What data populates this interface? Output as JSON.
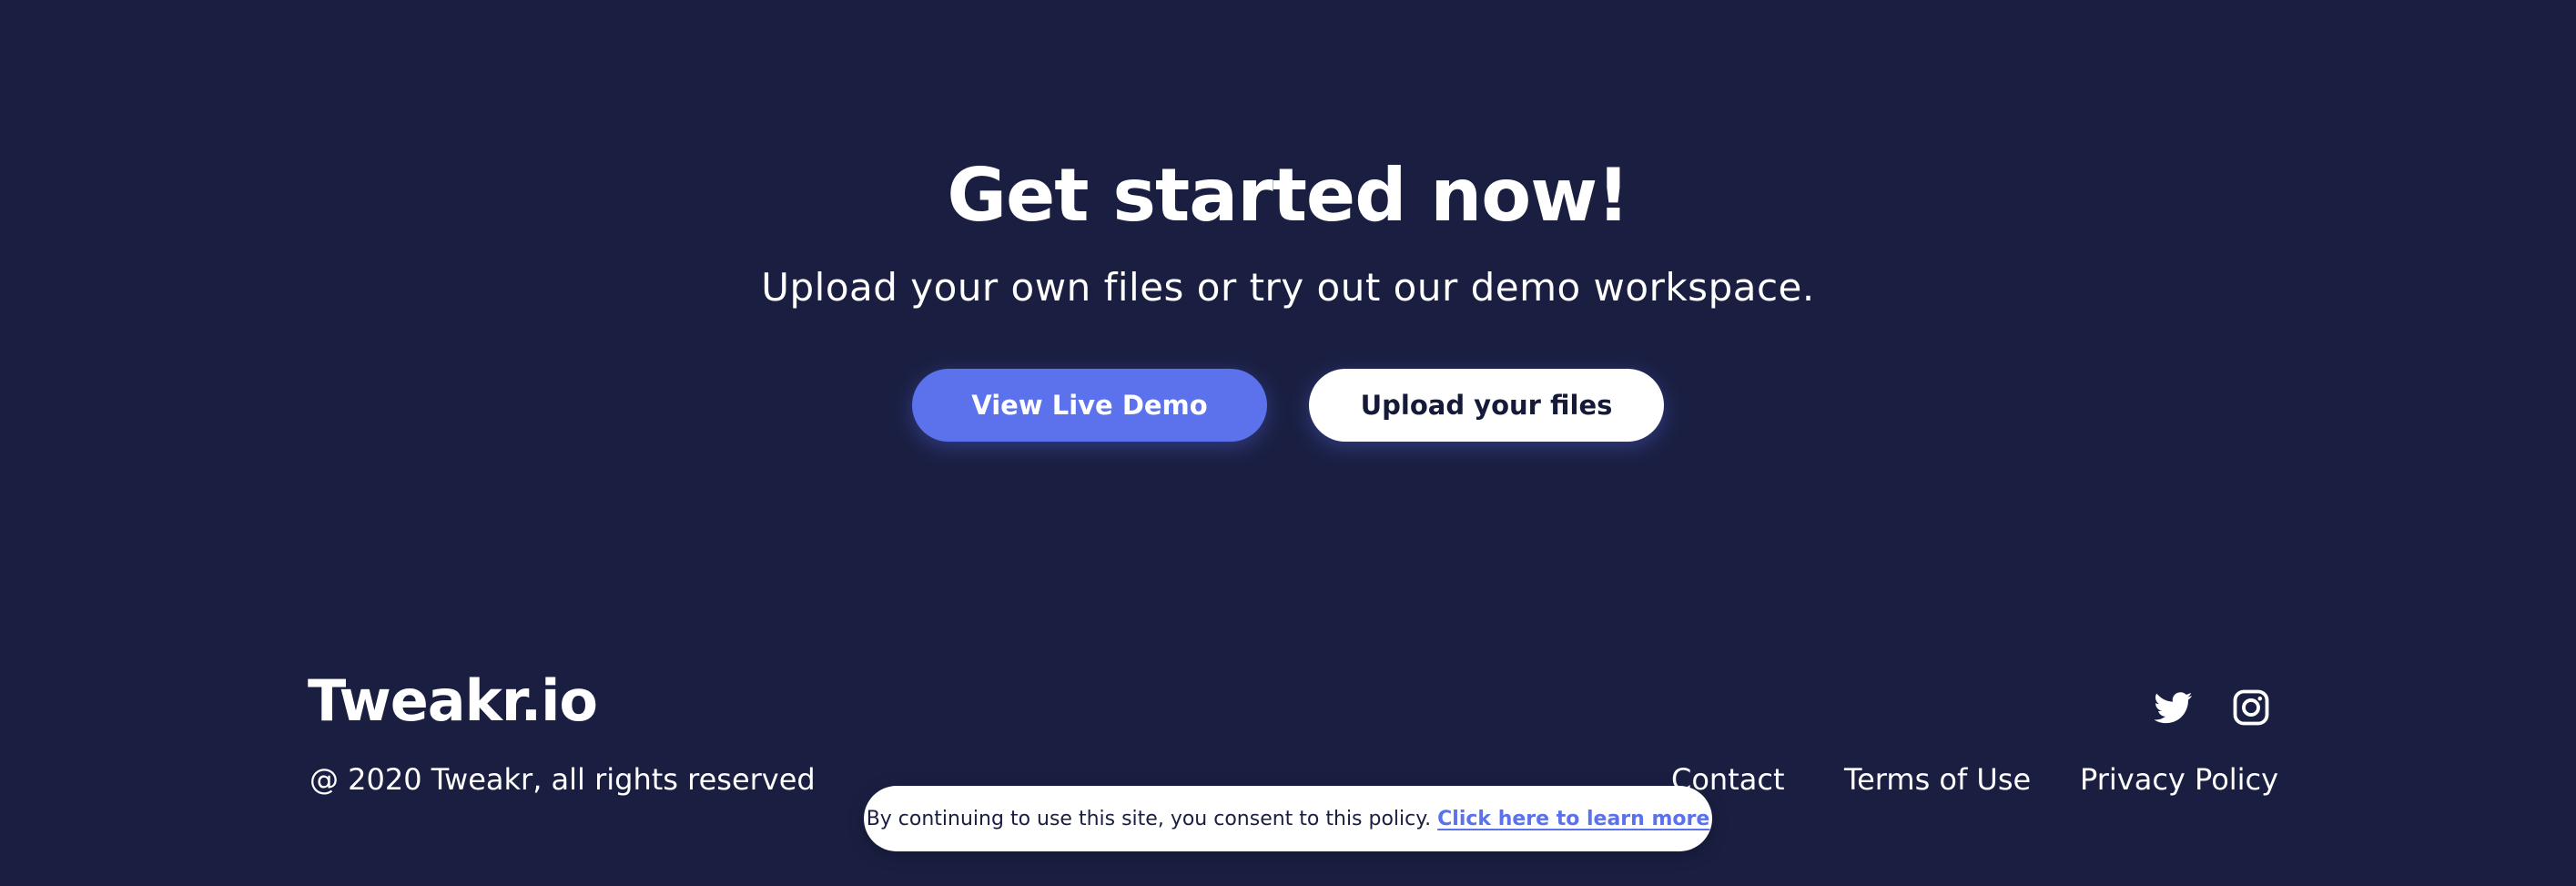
{
  "hero": {
    "title": "Get started now!",
    "subtitle": "Upload your own files or try out our demo workspace.",
    "primary_button_label": "View Live Demo",
    "secondary_button_label": "Upload your files"
  },
  "footer": {
    "logo_text": "Tweakr.io",
    "copyright": "@ 2020 Tweakr, all rights reserved",
    "social_icons": [
      "twitter-icon",
      "instagram-icon"
    ],
    "links": {
      "contact": "Contact",
      "terms": "Terms of Use",
      "privacy": "Privacy Policy"
    }
  },
  "cookie_banner": {
    "text": "By continuing to use this site, you consent to this policy.",
    "link_text": "Click here to learn more"
  },
  "colors": {
    "background": "#1a1f42",
    "accent": "#5b72ec",
    "text": "#ffffff"
  }
}
